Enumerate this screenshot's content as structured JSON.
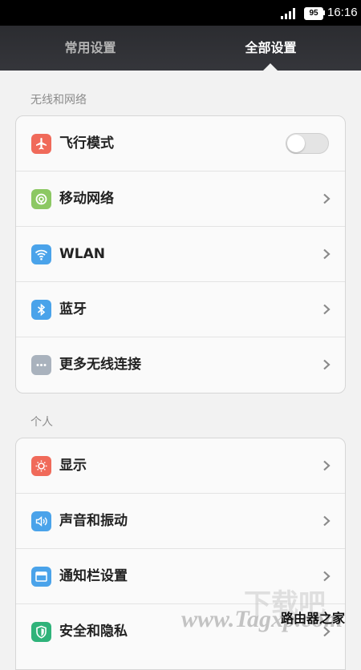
{
  "status_bar": {
    "battery": "95",
    "time": "16:16"
  },
  "tabs": [
    {
      "label": "常用设置",
      "active": false
    },
    {
      "label": "全部设置",
      "active": true
    }
  ],
  "sections": [
    {
      "title": "无线和网络",
      "items": [
        {
          "label": "飞行模式",
          "icon": "airplane-icon",
          "icon_color": "#f06a5a",
          "control": "toggle",
          "toggle_on": false
        },
        {
          "label": "移动网络",
          "icon": "mobile-network-icon",
          "icon_color": "#8cc863",
          "control": "chevron"
        },
        {
          "label": "WLAN",
          "icon": "wifi-icon",
          "icon_color": "#4aa3ea",
          "control": "chevron"
        },
        {
          "label": "蓝牙",
          "icon": "bluetooth-icon",
          "icon_color": "#4aa3ea",
          "control": "chevron"
        },
        {
          "label": "更多无线连接",
          "icon": "more-icon",
          "icon_color": "#a9b2bd",
          "control": "chevron"
        }
      ]
    },
    {
      "title": "个人",
      "items": [
        {
          "label": "显示",
          "icon": "display-icon",
          "icon_color": "#f06a5a",
          "control": "chevron"
        },
        {
          "label": "声音和振动",
          "icon": "sound-icon",
          "icon_color": "#4aa3ea",
          "control": "chevron"
        },
        {
          "label": "通知栏设置",
          "icon": "notification-bar-icon",
          "icon_color": "#4aa3ea",
          "control": "chevron"
        },
        {
          "label": "安全和隐私",
          "icon": "shield-icon",
          "icon_color": "#2fb37a",
          "control": "chevron"
        }
      ]
    }
  ],
  "watermark": {
    "top": "下载吧",
    "url": "www.Tagxp.com",
    "text": "路由器之家"
  }
}
